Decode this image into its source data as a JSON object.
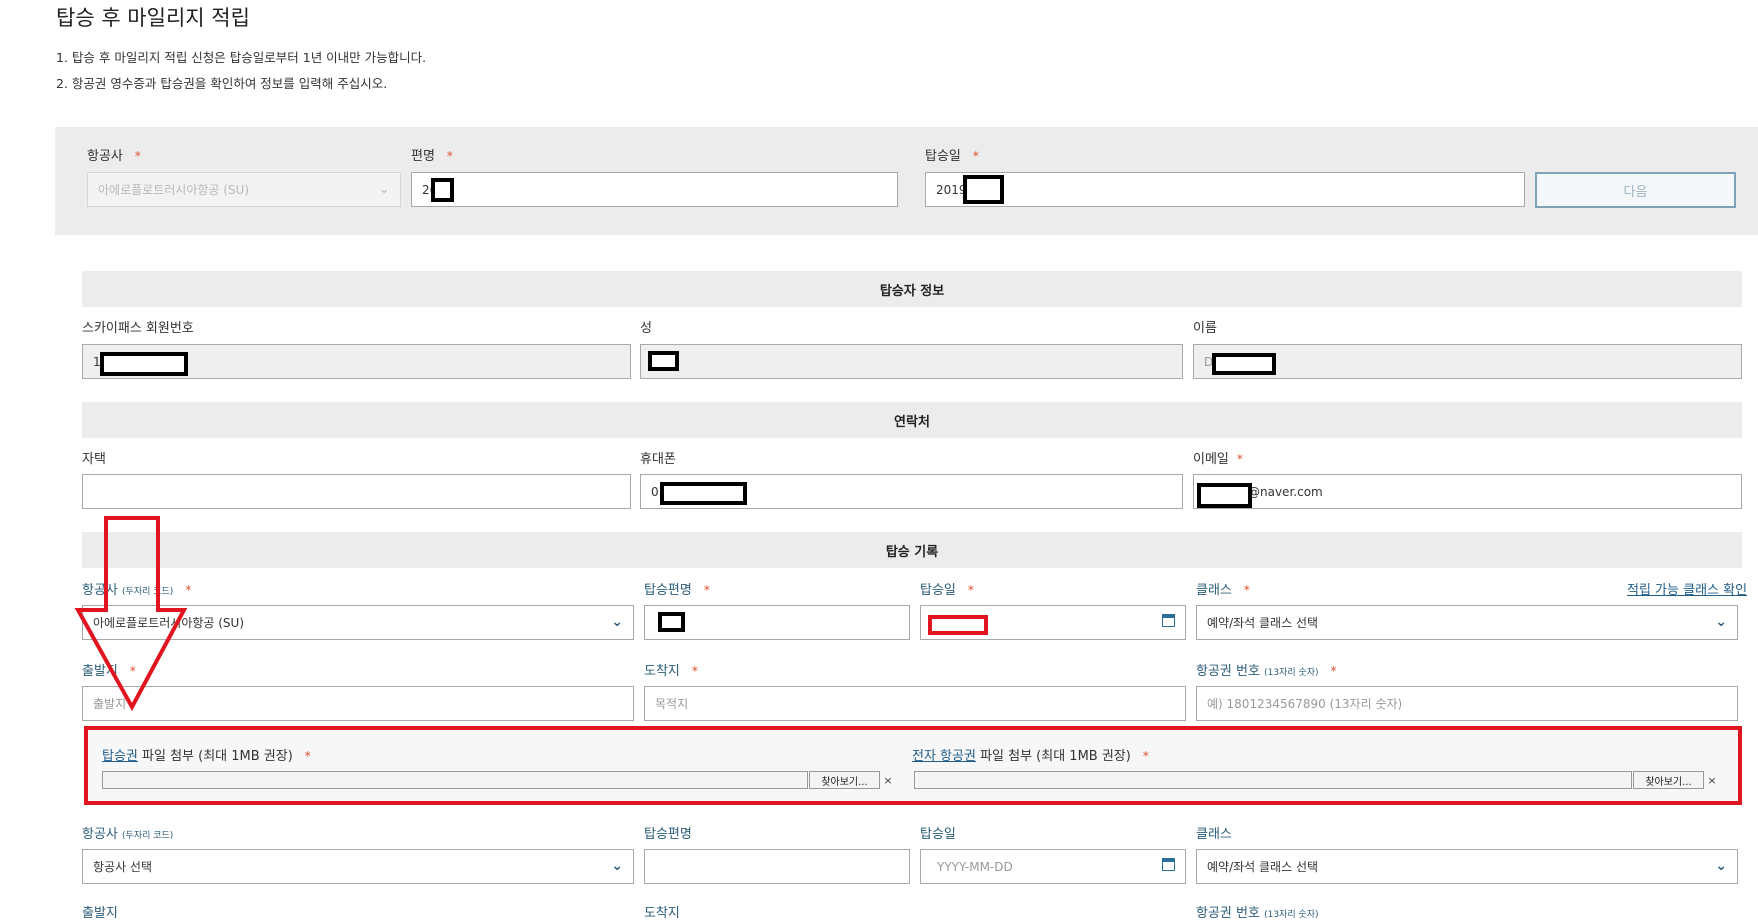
{
  "page": {
    "title": "탑승 후 마일리지 적립",
    "notes": [
      "1.  탑승 후 마일리지 적립 신청은 탑승일로부터 1년 이내만 가능합니다.",
      "2.  항공권 영수증과 탑승권을 확인하여 정보를 입력해 주십시오."
    ]
  },
  "search": {
    "airline_label": "항공사",
    "airline_value": "아에로플로트러시아항공 (SU)",
    "flight_label": "편명",
    "flight_value": "26",
    "date_label": "탑승일",
    "date_value": "2019",
    "next_button": "다음"
  },
  "passenger": {
    "section_title": "탑승자 정보",
    "member_label": "스카이패스 회원번호",
    "member_value": "1",
    "last_label": "성",
    "first_label": "이름",
    "first_value": "D"
  },
  "contact": {
    "section_title": "연락처",
    "home_label": "자택",
    "mobile_label": "휴대폰",
    "mobile_value": "01",
    "email_label": "이메일",
    "email_value": "@naver.com"
  },
  "record": {
    "section_title": "탑승 기록",
    "airline_label": "항공사",
    "airline_code": "(두자리 코드)",
    "flight_label": "탑승편명",
    "date_label": "탑승일",
    "class_label": "클래스",
    "class_link": "적립 가능 클래스 확인",
    "airline_value": "아에로플로트러시아항공 (SU)",
    "class_value": "예약/좌석 클래스 선택",
    "origin_label": "출발지",
    "origin_placeholder": "출발지",
    "dest_label": "도착지",
    "dest_placeholder": "목적지",
    "ticket_label": "항공권 번호",
    "ticket_hint": "(13자리 숫자)",
    "ticket_placeholder": "예) 1801234567890 (13자리 숫자)",
    "bp_link": "탑승권",
    "bp_text": " 파일 첨부 (최대 1MB 권장)",
    "et_link": "전자 항공권",
    "et_text": " 파일 첨부 (최대 1MB 권장)",
    "browse": "찾아보기...",
    "clear": "×"
  },
  "record2": {
    "airline_label": "항공사",
    "airline_code": "(두자리 코드)",
    "flight_label": "탑승편명",
    "date_label": "탑승일",
    "class_label": "클래스",
    "airline_value": "항공사 선택",
    "date_placeholder": "YYYY-MM-DD",
    "class_value": "예약/좌석 클래스 선택",
    "origin_label": "출발지",
    "dest_label": "도착지",
    "ticket_label": "항공권 번호",
    "ticket_hint": "(13자리 숫자)"
  },
  "required_mark": "*",
  "colors": {
    "annotation": "#e0151f",
    "accent": "#2a5d78"
  }
}
